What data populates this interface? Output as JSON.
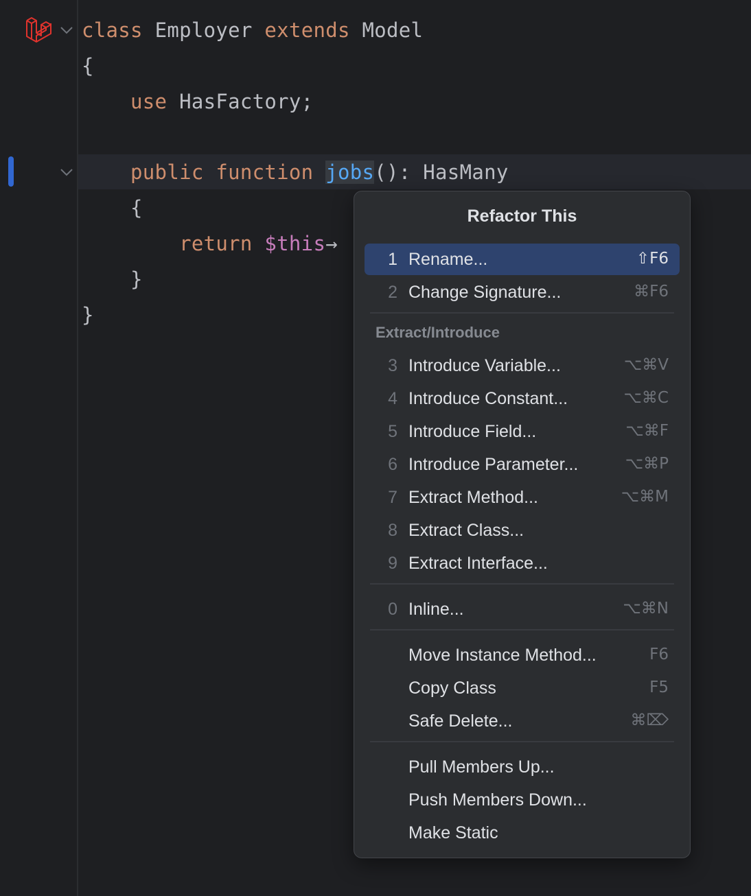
{
  "editor": {
    "lines": [
      {
        "tokens": [
          {
            "t": "class",
            "c": "kw"
          },
          {
            "t": " Employer ",
            "c": "ident"
          },
          {
            "t": "extends",
            "c": "kw"
          },
          {
            "t": " Model",
            "c": "ident"
          }
        ]
      },
      {
        "tokens": [
          {
            "t": "{",
            "c": "punct"
          }
        ]
      },
      {
        "tokens": [
          {
            "t": "    use",
            "c": "kw"
          },
          {
            "t": " HasFactory;",
            "c": "ident"
          }
        ]
      },
      {
        "tokens": []
      },
      {
        "tokens": [
          {
            "t": "    public function ",
            "c": "kw"
          },
          {
            "t": "jobs",
            "c": "fn"
          },
          {
            "t": "(): HasMany",
            "c": "ident"
          }
        ]
      },
      {
        "tokens": [
          {
            "t": "    {",
            "c": "punct"
          }
        ]
      },
      {
        "tokens": [
          {
            "t": "        return ",
            "c": "kw"
          },
          {
            "t": "$this",
            "c": "var"
          },
          {
            "t": "→",
            "c": "punct"
          }
        ]
      },
      {
        "tokens": [
          {
            "t": "    }",
            "c": "punct"
          }
        ]
      },
      {
        "tokens": [
          {
            "t": "}",
            "c": "punct"
          }
        ]
      }
    ],
    "gutter_icon": "laravel-icon"
  },
  "popup": {
    "title": "Refactor This",
    "items": [
      {
        "num": "1",
        "label": "Rename...",
        "shortcut": "⇧F6",
        "selected": true
      },
      {
        "num": "2",
        "label": "Change Signature...",
        "shortcut": "⌘F6"
      },
      {
        "separator": true
      },
      {
        "header": "Extract/Introduce"
      },
      {
        "num": "3",
        "label": "Introduce Variable...",
        "shortcut": "⌥⌘V"
      },
      {
        "num": "4",
        "label": "Introduce Constant...",
        "shortcut": "⌥⌘C"
      },
      {
        "num": "5",
        "label": "Introduce Field...",
        "shortcut": "⌥⌘F"
      },
      {
        "num": "6",
        "label": "Introduce Parameter...",
        "shortcut": "⌥⌘P"
      },
      {
        "num": "7",
        "label": "Extract Method...",
        "shortcut": "⌥⌘M"
      },
      {
        "num": "8",
        "label": "Extract Class...",
        "shortcut": ""
      },
      {
        "num": "9",
        "label": "Extract Interface...",
        "shortcut": ""
      },
      {
        "separator": true
      },
      {
        "num": "0",
        "label": "Inline...",
        "shortcut": "⌥⌘N"
      },
      {
        "separator": true
      },
      {
        "num": "",
        "label": "Move Instance Method...",
        "shortcut": "F6"
      },
      {
        "num": "",
        "label": "Copy Class",
        "shortcut": "F5"
      },
      {
        "num": "",
        "label": "Safe Delete...",
        "shortcut": "⌘⌦"
      },
      {
        "separator": true
      },
      {
        "num": "",
        "label": "Pull Members Up...",
        "shortcut": ""
      },
      {
        "num": "",
        "label": "Push Members Down...",
        "shortcut": ""
      },
      {
        "num": "",
        "label": "Make Static",
        "shortcut": ""
      }
    ]
  },
  "colors": {
    "background": "#1e1f22",
    "keyword": "#cf8e6d",
    "function": "#56a8f5",
    "variable": "#c77dbb",
    "selection": "#2e436e",
    "laravel_red": "#e0332d"
  }
}
